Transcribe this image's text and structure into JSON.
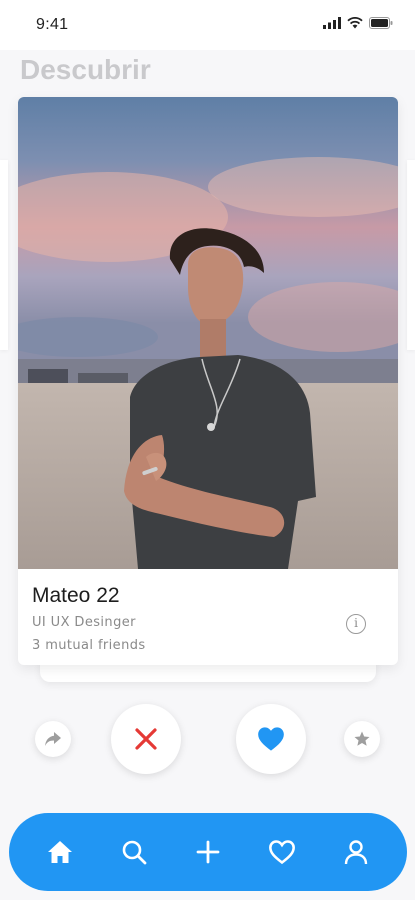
{
  "status_bar": {
    "time": "9:41",
    "icons": [
      "signal-icon",
      "wifi-icon",
      "battery-icon"
    ]
  },
  "page": {
    "title": "Descubrir"
  },
  "profile_card": {
    "name_age": "Mateo 22",
    "role": "UI UX Desinger",
    "mutual": "3 mutual friends",
    "info_icon": "info-icon"
  },
  "actions": [
    {
      "name": "share",
      "icon": "share-icon"
    },
    {
      "name": "reject",
      "icon": "close-icon",
      "color": "#e53935"
    },
    {
      "name": "like",
      "icon": "heart-icon",
      "color": "#2196f3"
    },
    {
      "name": "super-like",
      "icon": "star-icon"
    }
  ],
  "bottom_nav": {
    "background": "#2196f3",
    "items": [
      {
        "name": "home",
        "icon": "home-icon",
        "active": true
      },
      {
        "name": "search",
        "icon": "search-icon"
      },
      {
        "name": "add",
        "icon": "plus-icon"
      },
      {
        "name": "favorites",
        "icon": "heart-outline-icon"
      },
      {
        "name": "profile",
        "icon": "user-icon"
      }
    ]
  }
}
